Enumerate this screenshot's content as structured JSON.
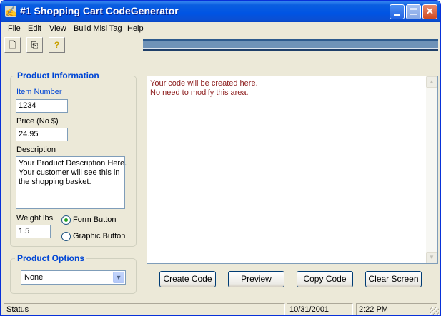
{
  "window": {
    "title": "#1 Shopping Cart CodeGenerator"
  },
  "menu": [
    "File",
    "Edit",
    "View",
    "Build Misl Tag",
    "Help"
  ],
  "product_info": {
    "legend": "Product Information",
    "item_number_label": "Item Number",
    "item_number_value": "1234",
    "price_label": "Price (No $)",
    "price_value": "24.95",
    "description_label": "Description",
    "description_lines": [
      "Your Product Description Here.",
      "Your customer will see this in",
      "the shopping basket."
    ],
    "weight_label": "Weight lbs",
    "weight_value": "1.5",
    "form_button_label": "Form Button",
    "graphic_button_label": "Graphic Button",
    "selected_button_type": "Form Button"
  },
  "product_options": {
    "legend": "Product Options",
    "selected": "None"
  },
  "output": {
    "lines": [
      "Your code will be created here.",
      "No need to modify this area."
    ]
  },
  "buttons": {
    "create_code": "Create Code",
    "preview": "Preview",
    "copy_code": "Copy Code",
    "clear_screen": "Clear Screen"
  },
  "status": {
    "text": "Status",
    "date": "10/31/2001",
    "time": "2:22 PM"
  },
  "icons": {
    "toolbar": [
      "new-document-icon",
      "copy-icon",
      "help-icon"
    ]
  }
}
